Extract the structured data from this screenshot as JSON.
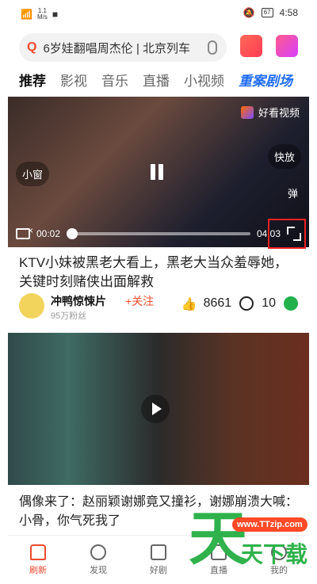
{
  "status_bar": {
    "signal": "1.1",
    "net": "M/s",
    "battery": "67",
    "time": "4:58"
  },
  "search": {
    "text": "6岁娃翻唱周杰伦 | 北京列车"
  },
  "tabs": [
    {
      "label": "推荐"
    },
    {
      "label": "影视"
    },
    {
      "label": "音乐"
    },
    {
      "label": "直播"
    },
    {
      "label": "小视频"
    },
    {
      "label": "重案剧场"
    }
  ],
  "video1": {
    "brand": "好看视频",
    "small_window": "小窗",
    "fast": "快放",
    "bullet": "弹",
    "time_current": "00:02",
    "time_total": "04:03",
    "title": "KTV小妹被黑老大看上，黑老大当众羞辱她，关键时刻赌侠出面解救",
    "author": "冲鸭惊悚片",
    "follow": "+关注",
    "fans": "95万粉丝",
    "likes": "8661",
    "comments": "10"
  },
  "video2": {
    "title": "偶像来了：赵丽颖谢娜竟又撞衫，谢娜崩溃大喊：小骨，你气死我了"
  },
  "nav": [
    {
      "label": "刷新",
      "icon": "home-icon"
    },
    {
      "label": "发现",
      "icon": "compass-icon"
    },
    {
      "label": "好剧",
      "icon": "tv-icon"
    },
    {
      "label": "直播",
      "icon": "live-icon"
    },
    {
      "label": "我的",
      "icon": "user-icon"
    }
  ],
  "watermark": {
    "url": "www.TTzip.com",
    "big": "天",
    "chars": "天下载"
  }
}
